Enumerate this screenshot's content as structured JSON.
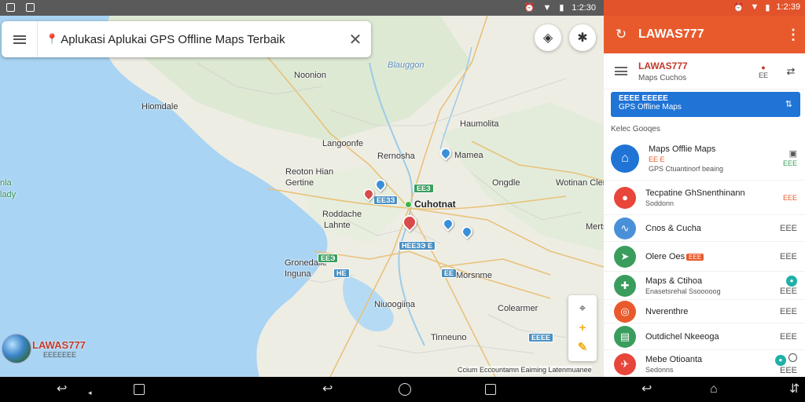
{
  "status_left": {
    "time": "1:2:30",
    "icons": [
      "image-icon",
      "file-icon",
      "alarm-icon",
      "wifi-icon",
      "battery-icon"
    ]
  },
  "status_right": {
    "time": "1:2:39",
    "icons": [
      "alarm-icon",
      "wifi-icon",
      "battery-icon"
    ]
  },
  "search": {
    "title": "Aplukasi Aplukai GPS Offline Maps Terbaik"
  },
  "map": {
    "labels": {
      "l_noonion": "Noonion",
      "l_blauggon": "Blauggon",
      "l_hiomdale": "Hiomdale",
      "l_haumolita": "Haumolita",
      "l_bangoonfe": "Langoonfe",
      "l_remnosha": "Rernosha",
      "l_reoton": "Reoton Hian",
      "l_gertine": "Gertine",
      "l_mamea": "Mamea",
      "l_cuhotnat": "Cuhotnat",
      "l_ongdle": "Ongdle",
      "l_wotinin": "Wotinan Clen",
      "l_roddache": "Roddache",
      "l_lahnte": "Lahnte",
      "l_merts": "Merts",
      "l_gronedalie": "Gronedalie",
      "l_inguna": "Inguna",
      "l_morsnme": "Morsnme",
      "l_nioognina": "Niuoogiina",
      "l_tirneuno": "Tinneuno",
      "l_colearmer": "Colearmer",
      "l_edge1": "nla",
      "l_edge2": "lady"
    },
    "badges": {
      "b1": "ЕЕЗ",
      "b2": "ЕЕЗЗ",
      "b3": "НЕЕЗЭ Е",
      "b4": "ЕЕЭ",
      "b5": "НЕ",
      "b6": "ЕЕ",
      "b7": "ЕЕЕЕ"
    },
    "attribution": "Ccium  Eccountamn Eaiming Latenmuanee"
  },
  "logo": {
    "name": "LAWAS777",
    "sub": "ЕЕЕЕЕЕЕ"
  },
  "appbar": {
    "title": "LAWAS777"
  },
  "panel_head": {
    "title": "LAWAS777",
    "subtitle": "Maps Cuchos",
    "mid": "ЕЕ"
  },
  "banner": {
    "line1": "ЕЕЕЕ ЕЕЕЕЕ",
    "line2": "GPS Offline Maps"
  },
  "section_label": "Kelec Gooqes",
  "list": [
    {
      "name": "Maps Offlie Maps",
      "sub": "GPS Ctuantinorf beaing",
      "pre": "ЕЕ  Е",
      "trail": "ЕЕЕ",
      "color": "#1f74d6",
      "icon": "home-icon"
    },
    {
      "name": "Tecpatine GhSnenthinann",
      "sub": "Soddonn",
      "trail": "ЕЕЕ",
      "color": "#e8463a",
      "icon": "pin-icon"
    },
    {
      "name": "Cnos & Cucha",
      "trail": "ЕЕЕ",
      "color": "#4a90d9",
      "icon": "route-icon"
    },
    {
      "name": "Olere Oes",
      "badge": "ЕЕЕ",
      "trail": "ЕЕЕ",
      "color": "#3a9d5d",
      "icon": "navigation-icon"
    },
    {
      "name": "Maps & Ctihoa",
      "sub": "Enasetsrehal Ssooooog",
      "trail": "ЕЕЕ",
      "color": "#3a9d5d",
      "icon": "walk-icon"
    },
    {
      "name": "Nverenthre",
      "trail": "ЕЕЕ",
      "color": "#e85a2c",
      "icon": "car-icon"
    },
    {
      "name": "Outdichel Nkeeoga",
      "trail": "ЕЕЕ",
      "color": "#3a9d5d",
      "icon": "bus-icon"
    },
    {
      "name": "Mebe Otioanta",
      "sub": "Sedonns",
      "trail": "ЕЕЕ",
      "color": "#e8463a",
      "icon": "plane-icon"
    }
  ],
  "colors": {
    "accent": "#e85a2c",
    "blue": "#1f74d6",
    "green": "#3a9d5d",
    "water": "#a9d4f3",
    "land": "#f1efe6"
  }
}
